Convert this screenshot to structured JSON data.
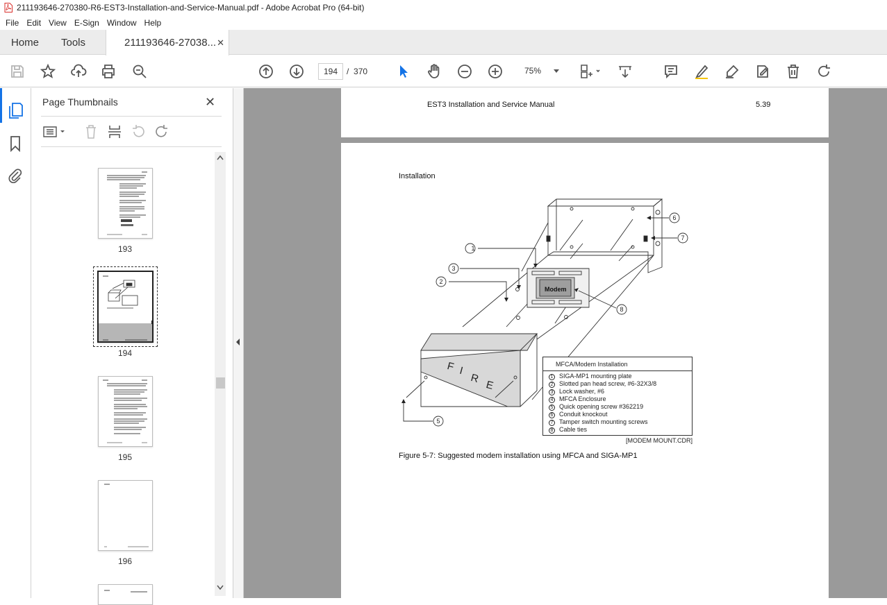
{
  "window": {
    "title": "211193646-270380-R6-EST3-Installation-and-Service-Manual.pdf - Adobe Acrobat Pro (64-bit)"
  },
  "menu": {
    "items": [
      "File",
      "Edit",
      "View",
      "E-Sign",
      "Window",
      "Help"
    ]
  },
  "tabs": {
    "home": "Home",
    "tools": "Tools",
    "document": "211193646-27038...",
    "close_glyph": "✕"
  },
  "toolbar": {
    "page_current": "194",
    "page_sep": "/",
    "page_total": "370",
    "zoom": "75%",
    "icons": [
      "save-icon",
      "star-icon",
      "upload-icon",
      "print-icon",
      "search-zoom-icon",
      "page-up-icon",
      "page-down-icon",
      "select-arrow-icon",
      "hand-icon",
      "zoom-out-icon",
      "zoom-in-icon",
      "fit-page-icon",
      "scroll-mode-icon",
      "comment-icon",
      "highlight-icon",
      "sign-icon",
      "edit-icon",
      "delete-icon",
      "rotate-icon"
    ]
  },
  "thumbnails_panel": {
    "title": "Page Thumbnails",
    "close_glyph": "✕",
    "pages": [
      {
        "label": "193",
        "selected": false
      },
      {
        "label": "194",
        "selected": true
      },
      {
        "label": "195",
        "selected": false
      },
      {
        "label": "196",
        "selected": false
      }
    ]
  },
  "document": {
    "prev_page": {
      "header_left": "EST3 Installation and Service Manual",
      "header_right": "5.39"
    },
    "current_page": {
      "section": "Installation",
      "figure": {
        "callouts": [
          "1",
          "2",
          "3",
          "5",
          "6",
          "7",
          "8"
        ],
        "modem_label": "Modem",
        "enclosure_letters": [
          "F",
          "I",
          "R",
          "E"
        ],
        "legend_title": "MFCA/Modem Installation",
        "legend_items": [
          {
            "n": "1",
            "text": "SIGA-MP1 mounting plate"
          },
          {
            "n": "2",
            "text": "Slotted pan head screw, #6-32X3/8"
          },
          {
            "n": "3",
            "text": "Lock washer, #6"
          },
          {
            "n": "4",
            "text": "MFCA Enclosure"
          },
          {
            "n": "5",
            "text": "Quick opening screw #362219"
          },
          {
            "n": "6",
            "text": "Conduit knockout"
          },
          {
            "n": "7",
            "text": "Tamper switch mounting screws"
          },
          {
            "n": "8",
            "text": "Cable ties"
          }
        ],
        "file_tag": "[MODEM MOUNT.CDR]",
        "caption": "Figure 5-7: Suggested modem installation using MFCA and SIGA-MP1"
      }
    }
  },
  "colors": {
    "doc_background": "#9a9a9a",
    "selection_blue": "#1473e6",
    "tab_bar": "#ececec"
  }
}
